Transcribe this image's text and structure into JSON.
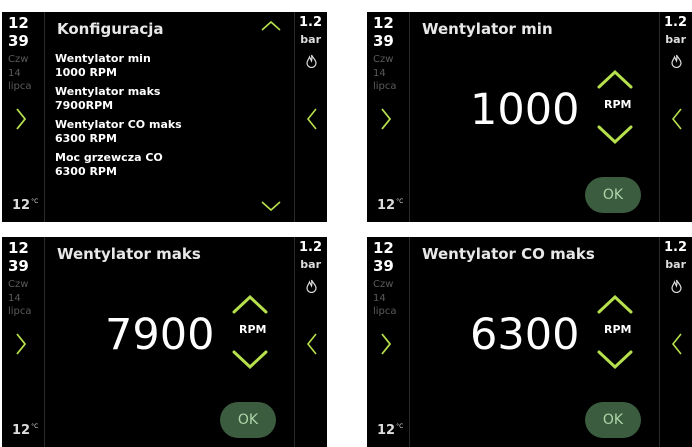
{
  "status": {
    "hour": "12",
    "minute": "39",
    "day": "Czw",
    "date": "14",
    "month": "lipca",
    "temperature": "12",
    "temperature_unit": "°C",
    "pressure": "1.2",
    "pressure_unit": "bar"
  },
  "colors": {
    "accent": "#b7e04d",
    "ok_bg": "#3b5c3f",
    "ok_text": "#aed5a8"
  },
  "config_panel": {
    "title": "Konfiguracja",
    "items": [
      {
        "label": "Wentylator min",
        "value": "1000 RPM"
      },
      {
        "label": "Wentylator maks",
        "value": "7900RPM"
      },
      {
        "label": "Wentylator CO maks",
        "value": "6300 RPM"
      },
      {
        "label": "Moc grzewcza CO",
        "value": "6300 RPM"
      }
    ]
  },
  "edit_panels": [
    {
      "title": "Wentylator min",
      "value": "1000",
      "unit": "RPM",
      "ok_label": "OK"
    },
    {
      "title": "Wentylator maks",
      "value": "7900",
      "unit": "RPM",
      "ok_label": "OK"
    },
    {
      "title": "Wentylator CO maks",
      "value": "6300",
      "unit": "RPM",
      "ok_label": "OK"
    }
  ],
  "icons": {
    "left": "chevron-right-icon",
    "right_flame": "flame-icon",
    "right_back": "chevron-left-icon",
    "value_up": "chevron-up-icon",
    "value_down": "chevron-down-icon"
  }
}
